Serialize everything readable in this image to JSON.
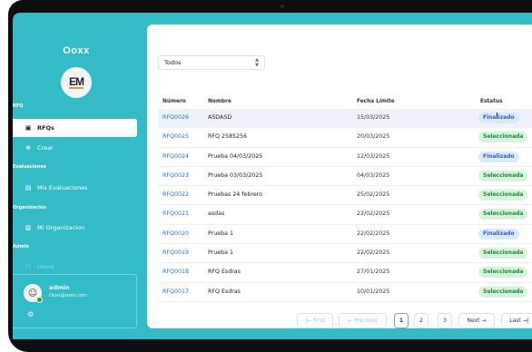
{
  "sidebar": {
    "brand": "Ooxx",
    "logo_text": "EM",
    "sections": {
      "rfq": "RFQ",
      "evaluaciones": "Evaluaciones",
      "organizacion": "Organización",
      "admin": "Admin"
    },
    "nav": {
      "rfqs": "RFQs",
      "crear": "Crear",
      "mis_evaluaciones": "Mis Evaluaciones",
      "mi_organizacion": "Mi Organizacion",
      "users": "Users"
    },
    "user": {
      "name": "admin",
      "email": "Ooxx@ooxx.com"
    }
  },
  "filter": {
    "selected": "Todos"
  },
  "table": {
    "headers": {
      "numero": "Número",
      "nombre": "Nombre",
      "fecha": "Fecha Límite",
      "estatus": "Estatus"
    },
    "rows": [
      {
        "numero": "RFQ0026",
        "nombre": "ASDASD",
        "fecha": "15/03/2025",
        "estatus": "Finalizado"
      },
      {
        "numero": "RFQ0025",
        "nombre": "RFQ 2585256",
        "fecha": "20/03/2025",
        "estatus": "Seleccionada"
      },
      {
        "numero": "RFQ0024",
        "nombre": "Prueba 04/03/2025",
        "fecha": "12/03/2025",
        "estatus": "Finalizado"
      },
      {
        "numero": "RFQ0023",
        "nombre": "Prueba 03/03/2025",
        "fecha": "04/03/2025",
        "estatus": "Seleccionada"
      },
      {
        "numero": "RFQ0022",
        "nombre": "Pruebas 24 febrero",
        "fecha": "25/02/2025",
        "estatus": "Seleccionada"
      },
      {
        "numero": "RFQ0021",
        "nombre": "asdas",
        "fecha": "22/02/2025",
        "estatus": "Seleccionada"
      },
      {
        "numero": "RFQ0020",
        "nombre": "Prueba 1",
        "fecha": "22/02/2025",
        "estatus": "Finalizado"
      },
      {
        "numero": "RFQ0019",
        "nombre": "Prueba 1",
        "fecha": "22/02/2025",
        "estatus": "Seleccionada"
      },
      {
        "numero": "RFQ0018",
        "nombre": "RFQ Esdras",
        "fecha": "27/01/2025",
        "estatus": "Seleccionada"
      },
      {
        "numero": "RFQ0017",
        "nombre": "RFQ Esdras",
        "fecha": "10/01/2025",
        "estatus": "Seleccionada"
      }
    ]
  },
  "pagination": {
    "first": "|← First",
    "previous": "← Previous",
    "pages": [
      "1",
      "2",
      "3"
    ],
    "current_page": "1",
    "next": "Next →",
    "last": "Last →|"
  },
  "colors": {
    "sidebar_bg": "#33bcc6",
    "badge_selected_bg": "#d6f3dd",
    "badge_selected_text": "#1f8a3b",
    "badge_finalizado_bg": "#dde8fb",
    "badge_finalizado_text": "#2d62c4",
    "link": "#2b6fd6"
  },
  "icons": {
    "rfqs": "document-icon",
    "crear": "plus-circle-icon",
    "mis_evaluaciones": "clipboard-icon",
    "mi_organizacion": "building-icon",
    "users": "users-icon",
    "settings": "gear-icon",
    "select": "chevron-updown-icon"
  }
}
